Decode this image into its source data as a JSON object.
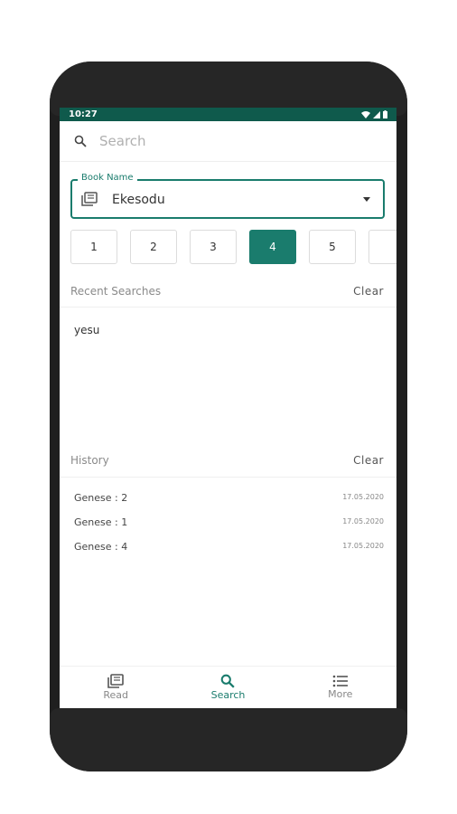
{
  "status_bar": {
    "time": "10:27"
  },
  "search": {
    "placeholder": "Search"
  },
  "book_selector": {
    "label": "Book Name",
    "value": "Ekesodu"
  },
  "chapters": [
    {
      "label": "1",
      "active": false
    },
    {
      "label": "2",
      "active": false
    },
    {
      "label": "3",
      "active": false
    },
    {
      "label": "4",
      "active": true
    },
    {
      "label": "5",
      "active": false
    }
  ],
  "recent_searches": {
    "title": "Recent Searches",
    "clear_label": "Clear",
    "items": [
      "yesu"
    ]
  },
  "history": {
    "title": "History",
    "clear_label": "Clear",
    "items": [
      {
        "reference": "Genese : 2",
        "date": "17.05.2020"
      },
      {
        "reference": "Genese : 1",
        "date": "17.05.2020"
      },
      {
        "reference": "Genese : 4",
        "date": "17.05.2020"
      }
    ]
  },
  "bottom_nav": {
    "items": [
      {
        "label": "Read",
        "icon": "book-icon"
      },
      {
        "label": "Search",
        "icon": "search-icon"
      },
      {
        "label": "More",
        "icon": "menu-icon"
      }
    ],
    "active_index": 1
  },
  "colors": {
    "accent": "#1a7c6d",
    "status_bar": "#0f5a4c"
  }
}
